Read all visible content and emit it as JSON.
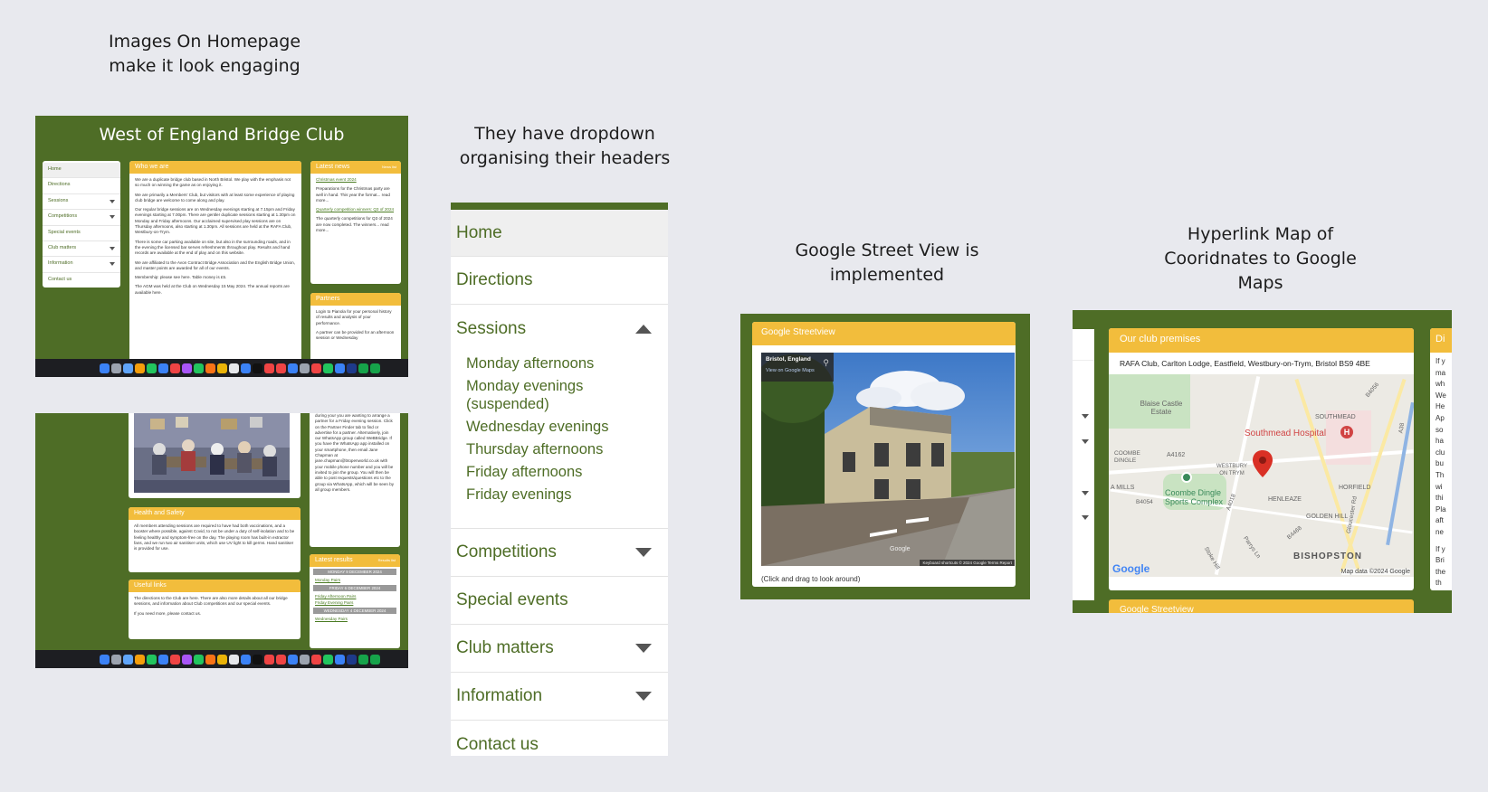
{
  "captions": {
    "homepage": [
      "Images On Homepage",
      "make it look engaging"
    ],
    "dropdown": [
      "They have dropdown",
      "organising their headers"
    ],
    "streetview": [
      "Google Street View is",
      "implemented"
    ],
    "map": [
      "Hyperlink Map of",
      "Cooridnates to Google",
      "Maps"
    ]
  },
  "site": {
    "title": "West of England Bridge Club",
    "sidebar": [
      "Home",
      "Directions",
      "Sessions",
      "Competitions",
      "Special events",
      "Club matters",
      "Information",
      "Contact us"
    ],
    "who_head": "Who we are",
    "who_paras": [
      "We are a duplicate bridge club based in North Bristol. We play with the emphasis not so much on winning the game as on enjoying it.",
      "We are primarily a Members' Club, but visitors with at least some experience of playing club bridge are welcome to come along and play.",
      "Our regular bridge sessions are on Wednesday evenings starting at 7.15pm and Friday evenings starting at 7.00pm. There are gentler duplicate sessions starting at 1.30pm on Monday and Friday afternoons. Our acclaimed supervised play sessions are on Thursday afternoons, also starting at 1.30pm. All sessions are held at the RAFA Club, Westbury-on-Trym.",
      "There is some car parking available on site, but also in the surrounding roads, and in the evening the licensed bar serves refreshments throughout play. Results and hand records are available at the end of play and on this website.",
      "We are affiliated to the Avon Contract Bridge Association and the English Bridge Union, and master points are awarded for all of our events.",
      "Membership: please see here. Table money is £5.",
      "The AGM was held at the Club on Wednesday 15 May 2024. The annual reports are available here."
    ],
    "news_head": "Latest news",
    "news_more": "News list",
    "news_link1": "Christmas event 2024",
    "news_text1": "Preparations for the Christmas party are well in hand. This year the format... read more...",
    "news_link2": "Quarterly competition winners: Q3 of 2024",
    "news_text2": "The quarterly competitions for Q3 of 2024 are now completed. The winners... read more...",
    "partners_head": "Partners",
    "partners_text": "Login to Pianola for your personal history of results and analysis of your performance.",
    "partners_text2": "A partner can be provided for an afternoon session or Wednesday",
    "hs_head": "Health and Safety",
    "hs_text": "All members attending sessions are required to have had both vaccinations, and a booster where possible, against Covid, to not be under a duty of self-isolation and to be feeling healthy and symptom-free on the day. The playing room has built-in extractor fans, and we run two air sanitiser units, which use UV light to kill germs. Hand sanitiser is provided for use.",
    "useful_head": "Useful links",
    "useful_text": "The directions to the Club are here. There are also more details about all our bridge sessions, and information about Club competitions and our special events.",
    "useful_text2": "If you need more, please contact us.",
    "results_head": "Latest results",
    "results_more": "Results list",
    "results": [
      {
        "date": "MONDAY 9 DECEMBER 2024",
        "links": [
          "Monday Pairs"
        ]
      },
      {
        "date": "FRIDAY 6 DECEMBER 2024",
        "links": [
          "Friday Afternoon Pairs",
          "Friday Evening Pairs"
        ]
      },
      {
        "date": "WEDNESDAY 4 DECEMBER 2024",
        "links": [
          "Wednesday Pairs"
        ]
      }
    ],
    "partner_finder_text": "during your you are wanting to arrange a partner for a Friday evening session. Click on the Partner Finder tab to find or advertise for a partner. Alternatively, join our WhatsApp group called WeBBridge. If you have the WhatsApp app installed on your smartphone, then email Jane Chapman at jane.chapman@btopenworld.co.uk with your mobile phone number and you will be invited to join the group. You will then be able to post requests/questions etc to the group via WhatsApp, which will be seen by all group members."
  },
  "nav_menu": {
    "items": [
      "Home",
      "Directions",
      "Sessions",
      "Competitions",
      "Special events",
      "Club matters",
      "Information",
      "Contact us"
    ],
    "sessions_sub": [
      "Monday afternoons",
      "Monday evenings (suspended)",
      "Wednesday evenings",
      "Thursday afternoons",
      "Friday afternoons",
      "Friday evenings"
    ]
  },
  "streetview": {
    "head": "Google Streetview",
    "location": "Bristol, England",
    "view_link": "View on Google Maps",
    "footer_overlay": "Keyboard shortcuts  © 2024 Google  Terms  Report",
    "google_mark": "Google",
    "caption": "(Click and drag to look around)"
  },
  "premises": {
    "head": "Our club premises",
    "address": "RAFA Club, Carlton Lodge, Eastfield, Westbury-on-Trym, Bristol BS9 4BE",
    "map_labels": [
      "Blaise Castle Estate",
      "SOUTHMEAD",
      "Southmead Hospital",
      "COOMBE DINGLE",
      "A4162",
      "WESTBURY ON TRYM",
      "Coombe Dingle Sports Complex",
      "A MILLS",
      "B4054",
      "HENLEAZE",
      "HORFIELD",
      "GOLDEN HILL",
      "BISHOPSTON",
      "B4056",
      "A38",
      "B4468",
      "A4018",
      "Gloucester Rd",
      "Parrys Ln",
      "Stoke Hill"
    ],
    "google_logo": "Google",
    "map_data": "Map data ©2024 Google",
    "next_head": "Google Streetview",
    "right_col_peek": "Di",
    "right_col_lines": [
      "If y",
      "ma",
      "wh",
      "We",
      "He",
      "Ap",
      "so",
      "ha",
      "clu",
      "bu",
      "Th",
      "wi",
      "thi",
      "Pla",
      "aft",
      "ne",
      "",
      "If y",
      "Bri",
      "the",
      "th"
    ]
  },
  "colors": {
    "green": "#4e6d26",
    "yellow": "#f2bd3c",
    "page_bg": "#e8e9ee"
  }
}
